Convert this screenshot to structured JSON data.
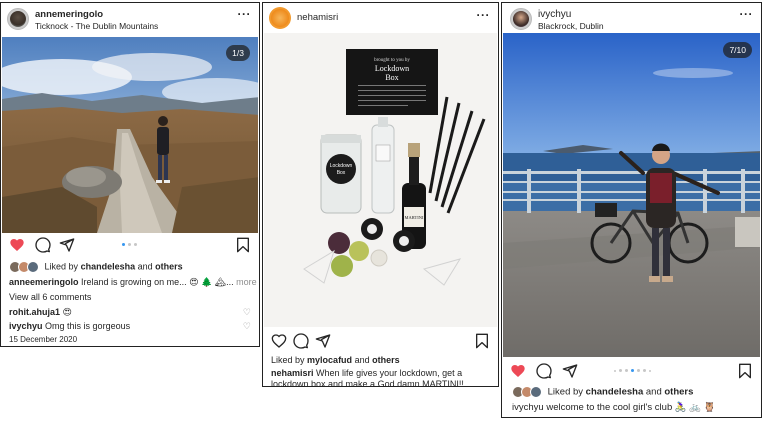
{
  "posts": [
    {
      "username": "annemeringolo",
      "location": "Ticknock - The Dublin Mountains",
      "counter": "1/3",
      "liked_prefix": "Liked by",
      "liked_user": "chandelesha",
      "liked_and": "and",
      "liked_others": "others",
      "caption_user": "anneemeringolo",
      "caption_text": "Ireland is growing on me... 😍 🌲 🏔...",
      "more": "more",
      "view_comments": "View all 6 comments",
      "comments": [
        {
          "user": "rohit.ahuja1",
          "text": "😍"
        },
        {
          "user": "ivychyu",
          "text": "Omg this is gorgeous"
        }
      ],
      "date": "15 December 2020",
      "liked": true
    },
    {
      "username": "nehamisri",
      "liked_prefix": "Liked by",
      "liked_user": "mylocafud",
      "liked_and": "and",
      "liked_others": "others",
      "caption_user": "nehamisri",
      "caption_text": "When life gives your lockdown, get a lockdown box and make a God damn MARTINI!!",
      "box_title_1": "Lockdown",
      "box_title_2": "Box",
      "box_subtitle": "brought to you by",
      "jar_label_1": "Lockdown",
      "jar_label_2": "Box",
      "bottle_label": "MARTINI",
      "liked": false
    },
    {
      "username": "ivychyu",
      "location": "Blackrock, Dublin",
      "counter": "7/10",
      "liked_prefix": "Liked by",
      "liked_user": "chandelesha",
      "liked_and": "and",
      "liked_others": "others",
      "caption_user": "ivychyu",
      "caption_text": "welcome to the cool girl's club 🚴‍♀️ 🚲 🦉",
      "liked": true
    }
  ],
  "icons": {
    "heart": "heart-icon",
    "comment": "comment-icon",
    "share": "send-icon",
    "bookmark": "bookmark-icon",
    "more": "more-icon"
  },
  "colors": {
    "like_red": "#ed4956",
    "dot_active": "#3897f0",
    "text": "#262626",
    "muted": "#8e8e8e"
  }
}
